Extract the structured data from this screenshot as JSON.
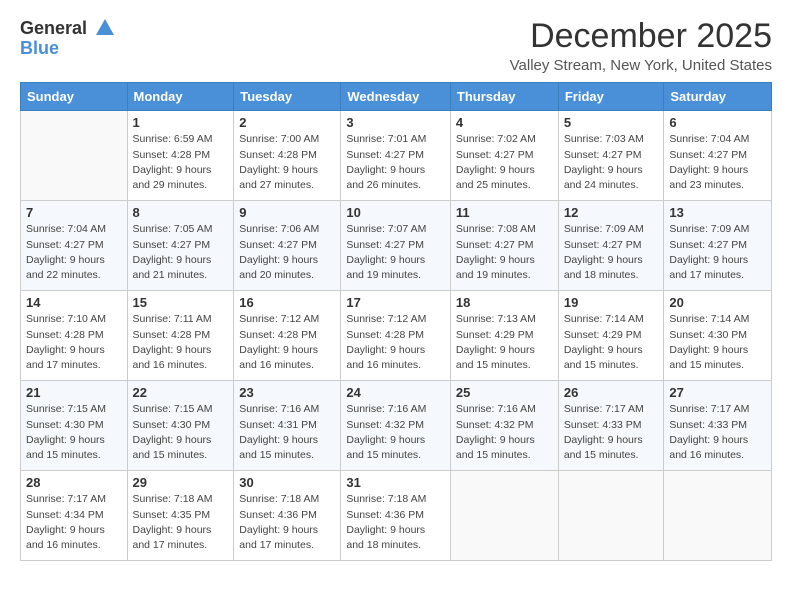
{
  "header": {
    "logo_general": "General",
    "logo_blue": "Blue",
    "title": "December 2025",
    "subtitle": "Valley Stream, New York, United States"
  },
  "calendar": {
    "days_of_week": [
      "Sunday",
      "Monday",
      "Tuesday",
      "Wednesday",
      "Thursday",
      "Friday",
      "Saturday"
    ],
    "weeks": [
      [
        {
          "day": "",
          "detail": ""
        },
        {
          "day": "1",
          "detail": "Sunrise: 6:59 AM\nSunset: 4:28 PM\nDaylight: 9 hours\nand 29 minutes."
        },
        {
          "day": "2",
          "detail": "Sunrise: 7:00 AM\nSunset: 4:28 PM\nDaylight: 9 hours\nand 27 minutes."
        },
        {
          "day": "3",
          "detail": "Sunrise: 7:01 AM\nSunset: 4:27 PM\nDaylight: 9 hours\nand 26 minutes."
        },
        {
          "day": "4",
          "detail": "Sunrise: 7:02 AM\nSunset: 4:27 PM\nDaylight: 9 hours\nand 25 minutes."
        },
        {
          "day": "5",
          "detail": "Sunrise: 7:03 AM\nSunset: 4:27 PM\nDaylight: 9 hours\nand 24 minutes."
        },
        {
          "day": "6",
          "detail": "Sunrise: 7:04 AM\nSunset: 4:27 PM\nDaylight: 9 hours\nand 23 minutes."
        }
      ],
      [
        {
          "day": "7",
          "detail": "Sunrise: 7:04 AM\nSunset: 4:27 PM\nDaylight: 9 hours\nand 22 minutes."
        },
        {
          "day": "8",
          "detail": "Sunrise: 7:05 AM\nSunset: 4:27 PM\nDaylight: 9 hours\nand 21 minutes."
        },
        {
          "day": "9",
          "detail": "Sunrise: 7:06 AM\nSunset: 4:27 PM\nDaylight: 9 hours\nand 20 minutes."
        },
        {
          "day": "10",
          "detail": "Sunrise: 7:07 AM\nSunset: 4:27 PM\nDaylight: 9 hours\nand 19 minutes."
        },
        {
          "day": "11",
          "detail": "Sunrise: 7:08 AM\nSunset: 4:27 PM\nDaylight: 9 hours\nand 19 minutes."
        },
        {
          "day": "12",
          "detail": "Sunrise: 7:09 AM\nSunset: 4:27 PM\nDaylight: 9 hours\nand 18 minutes."
        },
        {
          "day": "13",
          "detail": "Sunrise: 7:09 AM\nSunset: 4:27 PM\nDaylight: 9 hours\nand 17 minutes."
        }
      ],
      [
        {
          "day": "14",
          "detail": "Sunrise: 7:10 AM\nSunset: 4:28 PM\nDaylight: 9 hours\nand 17 minutes."
        },
        {
          "day": "15",
          "detail": "Sunrise: 7:11 AM\nSunset: 4:28 PM\nDaylight: 9 hours\nand 16 minutes."
        },
        {
          "day": "16",
          "detail": "Sunrise: 7:12 AM\nSunset: 4:28 PM\nDaylight: 9 hours\nand 16 minutes."
        },
        {
          "day": "17",
          "detail": "Sunrise: 7:12 AM\nSunset: 4:28 PM\nDaylight: 9 hours\nand 16 minutes."
        },
        {
          "day": "18",
          "detail": "Sunrise: 7:13 AM\nSunset: 4:29 PM\nDaylight: 9 hours\nand 15 minutes."
        },
        {
          "day": "19",
          "detail": "Sunrise: 7:14 AM\nSunset: 4:29 PM\nDaylight: 9 hours\nand 15 minutes."
        },
        {
          "day": "20",
          "detail": "Sunrise: 7:14 AM\nSunset: 4:30 PM\nDaylight: 9 hours\nand 15 minutes."
        }
      ],
      [
        {
          "day": "21",
          "detail": "Sunrise: 7:15 AM\nSunset: 4:30 PM\nDaylight: 9 hours\nand 15 minutes."
        },
        {
          "day": "22",
          "detail": "Sunrise: 7:15 AM\nSunset: 4:30 PM\nDaylight: 9 hours\nand 15 minutes."
        },
        {
          "day": "23",
          "detail": "Sunrise: 7:16 AM\nSunset: 4:31 PM\nDaylight: 9 hours\nand 15 minutes."
        },
        {
          "day": "24",
          "detail": "Sunrise: 7:16 AM\nSunset: 4:32 PM\nDaylight: 9 hours\nand 15 minutes."
        },
        {
          "day": "25",
          "detail": "Sunrise: 7:16 AM\nSunset: 4:32 PM\nDaylight: 9 hours\nand 15 minutes."
        },
        {
          "day": "26",
          "detail": "Sunrise: 7:17 AM\nSunset: 4:33 PM\nDaylight: 9 hours\nand 15 minutes."
        },
        {
          "day": "27",
          "detail": "Sunrise: 7:17 AM\nSunset: 4:33 PM\nDaylight: 9 hours\nand 16 minutes."
        }
      ],
      [
        {
          "day": "28",
          "detail": "Sunrise: 7:17 AM\nSunset: 4:34 PM\nDaylight: 9 hours\nand 16 minutes."
        },
        {
          "day": "29",
          "detail": "Sunrise: 7:18 AM\nSunset: 4:35 PM\nDaylight: 9 hours\nand 17 minutes."
        },
        {
          "day": "30",
          "detail": "Sunrise: 7:18 AM\nSunset: 4:36 PM\nDaylight: 9 hours\nand 17 minutes."
        },
        {
          "day": "31",
          "detail": "Sunrise: 7:18 AM\nSunset: 4:36 PM\nDaylight: 9 hours\nand 18 minutes."
        },
        {
          "day": "",
          "detail": ""
        },
        {
          "day": "",
          "detail": ""
        },
        {
          "day": "",
          "detail": ""
        }
      ]
    ]
  }
}
